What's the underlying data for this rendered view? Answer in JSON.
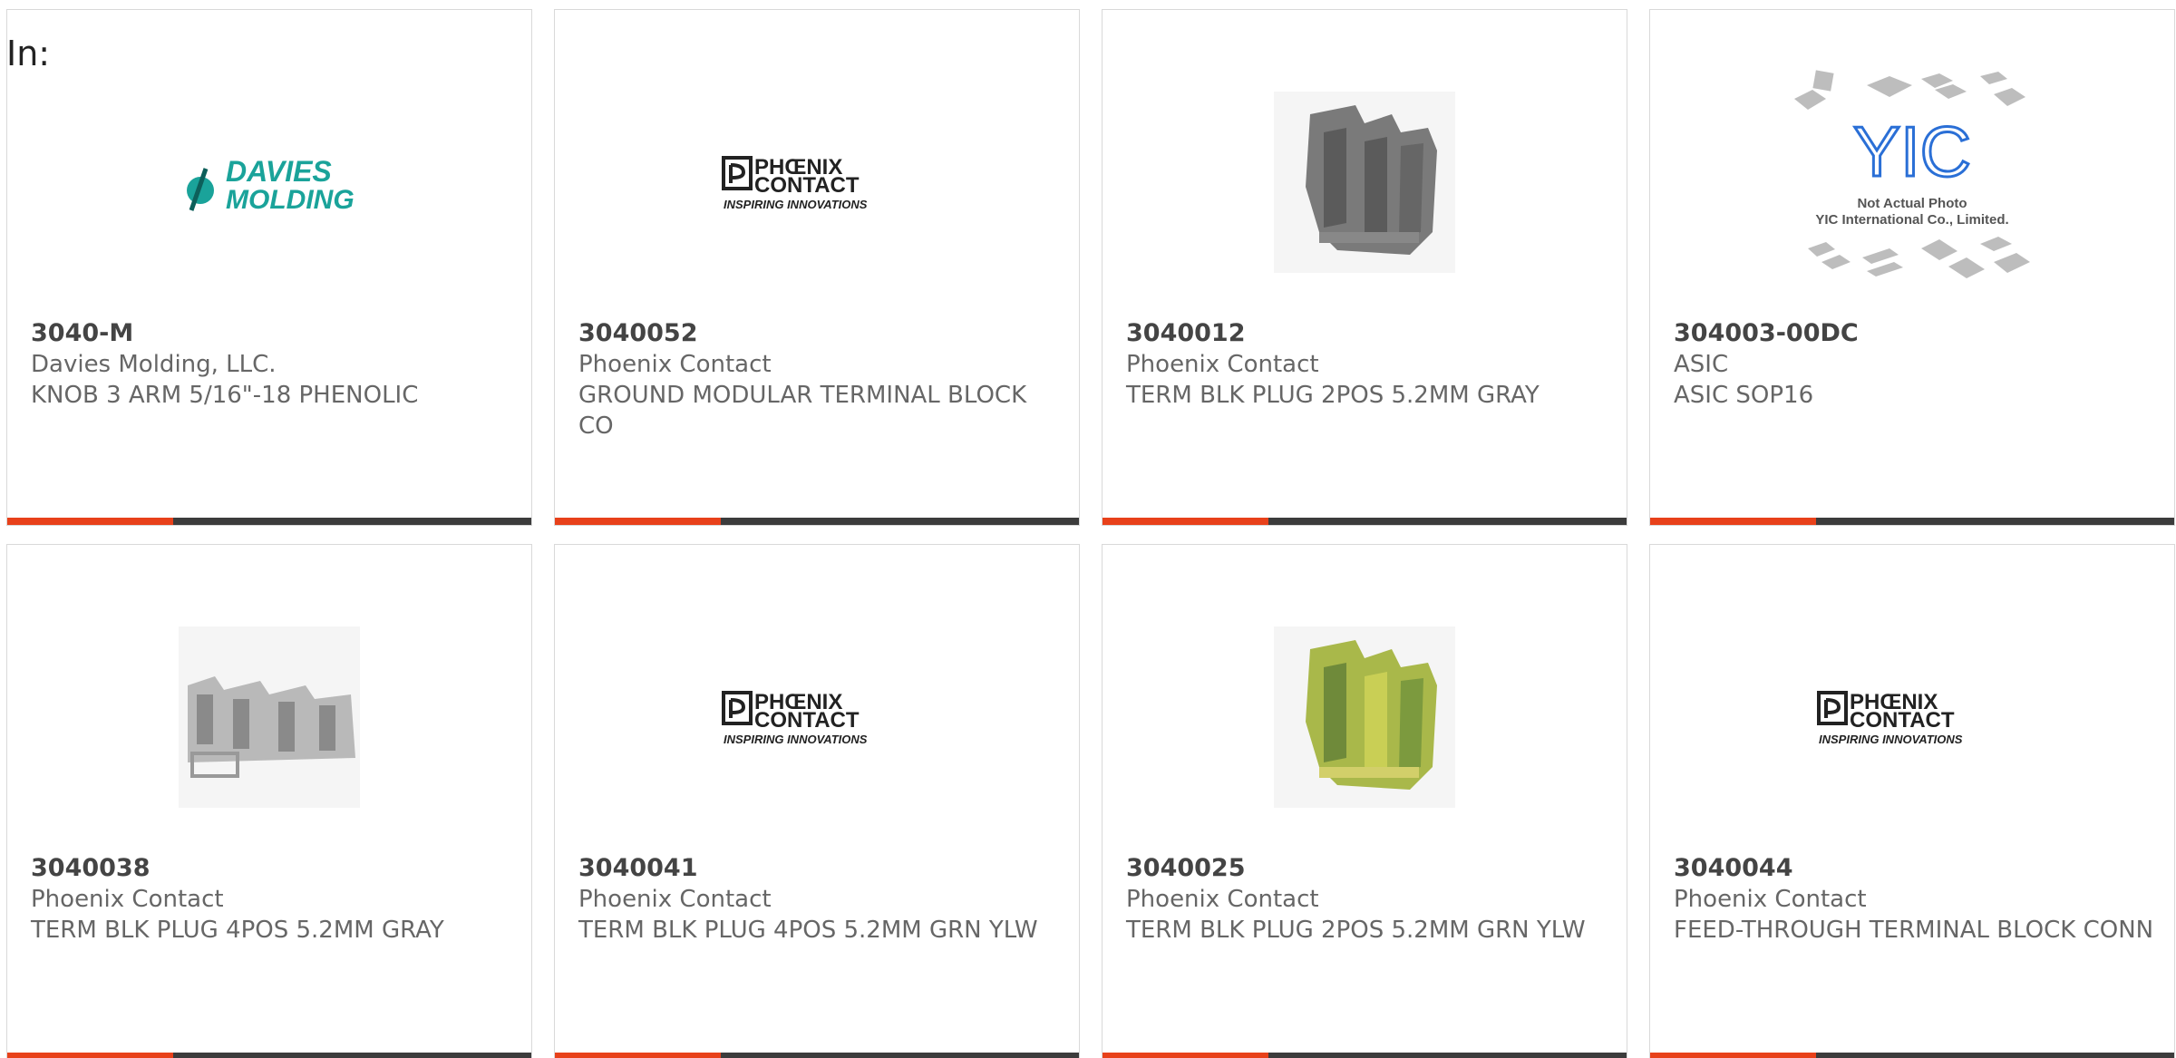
{
  "header": {
    "in_label": "In:"
  },
  "colors": {
    "accent": "#e8411a",
    "bar_dark": "#3c3c3c",
    "text": "#666666",
    "border": "#d9d9d9"
  },
  "logos": {
    "davies": {
      "line1": "DAVIES",
      "line2": "MOLDING"
    },
    "phoenix": {
      "line1": "PHŒNIX",
      "line2": "CONTACT",
      "tagline": "INSPIRING INNOVATIONS"
    },
    "yic": {
      "mark": "YIC",
      "line1": "Not Actual Photo",
      "line2": "YIC International Co., Limited."
    }
  },
  "products": [
    {
      "part": "3040-M",
      "manufacturer": "Davies Molding, LLC.",
      "description": "KNOB 3 ARM 5/16\"-18 PHENOLIC",
      "image": "davies-logo"
    },
    {
      "part": "3040052",
      "manufacturer": "Phoenix Contact",
      "description": "GROUND MODULAR TERMINAL BLOCK CO",
      "image": "phoenix-logo"
    },
    {
      "part": "3040012",
      "manufacturer": "Phoenix Contact",
      "description": "TERM BLK PLUG 2POS 5.2MM GRAY",
      "image": "terminal-block-gray-photo"
    },
    {
      "part": "304003-00DC",
      "manufacturer": "ASIC",
      "description": "ASIC SOP16",
      "image": "yic-placeholder"
    },
    {
      "part": "3040038",
      "manufacturer": "Phoenix Contact",
      "description": "TERM BLK PLUG 4POS 5.2MM GRAY",
      "image": "terminal-block-4pos-gray-photo"
    },
    {
      "part": "3040041",
      "manufacturer": "Phoenix Contact",
      "description": "TERM BLK PLUG 4POS 5.2MM GRN YLW",
      "image": "phoenix-logo"
    },
    {
      "part": "3040025",
      "manufacturer": "Phoenix Contact",
      "description": "TERM BLK PLUG 2POS 5.2MM GRN YLW",
      "image": "terminal-block-green-yellow-photo"
    },
    {
      "part": "3040044",
      "manufacturer": "Phoenix Contact",
      "description": "FEED-THROUGH TERMINAL BLOCK CONN",
      "image": "phoenix-logo"
    }
  ]
}
